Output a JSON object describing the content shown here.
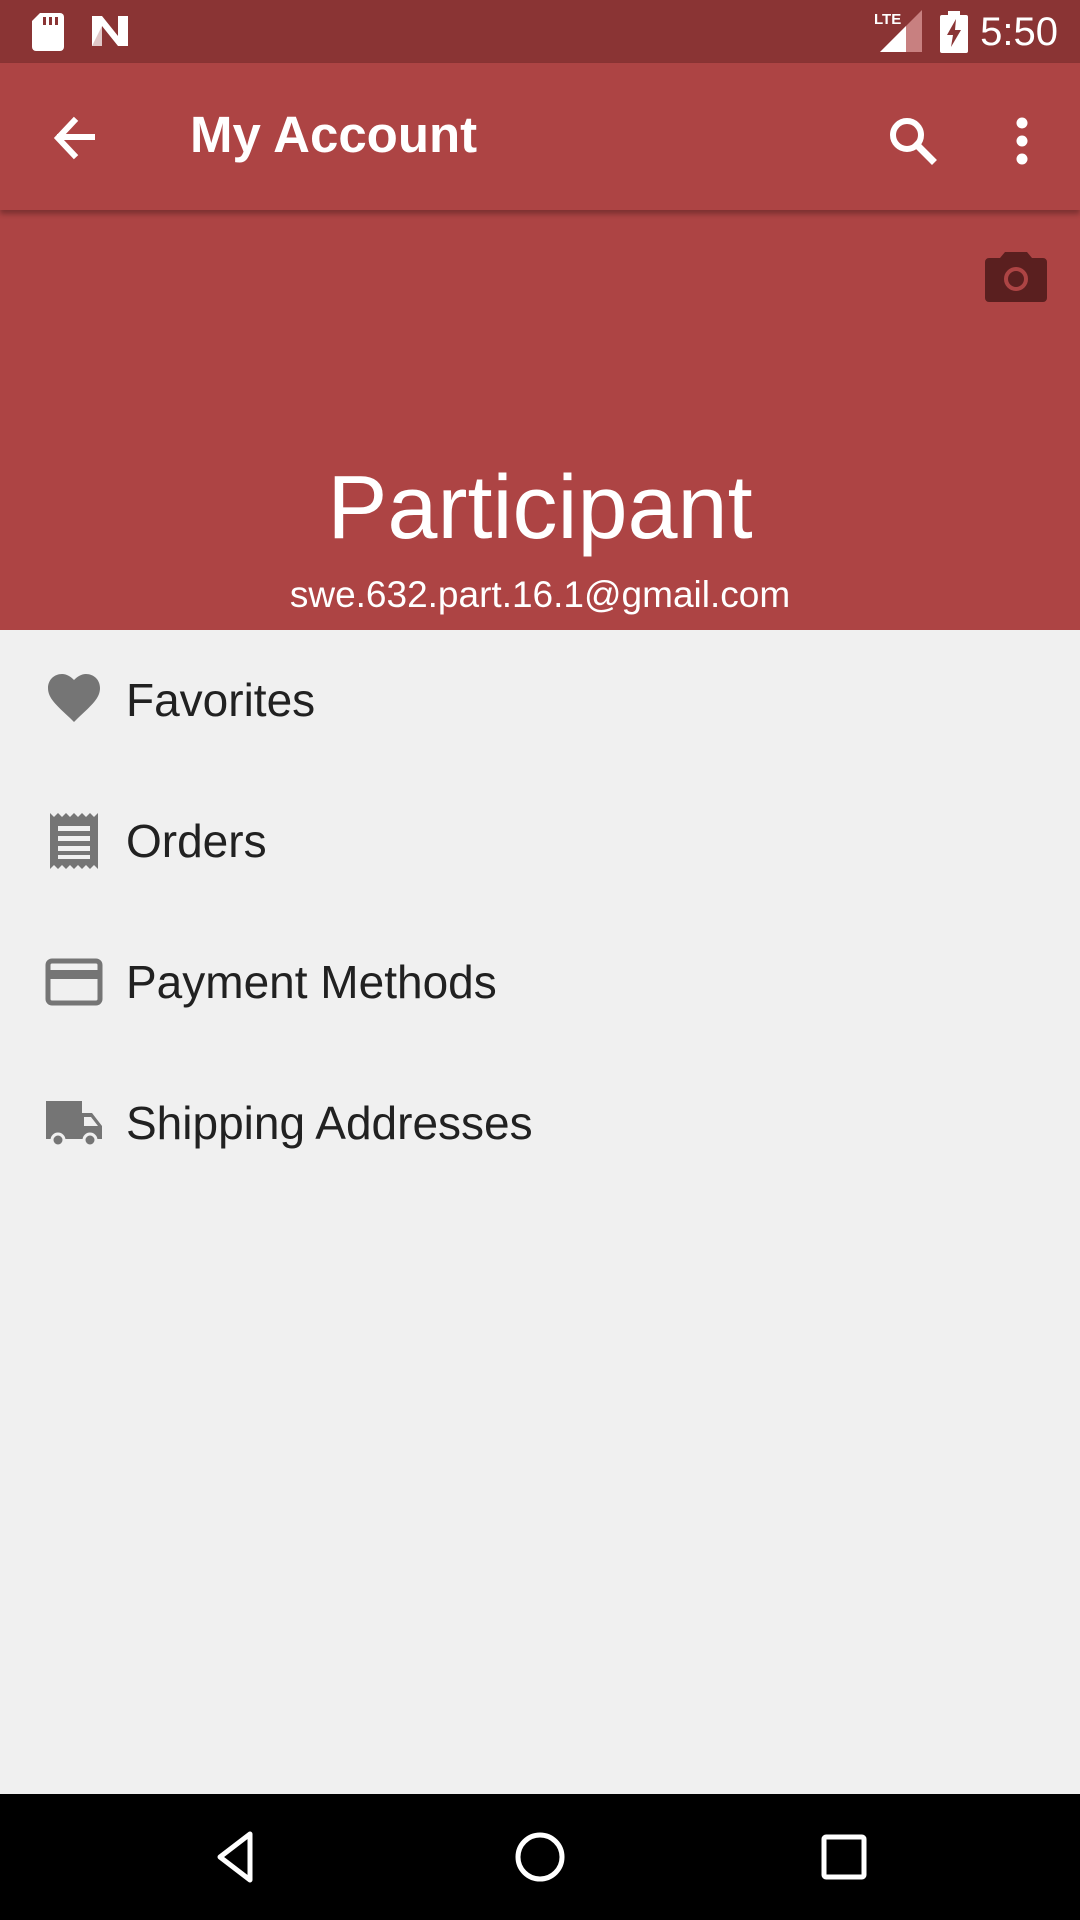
{
  "status_bar": {
    "time": "5:50",
    "icons": [
      "sd-card-icon",
      "n-logo-icon",
      "lte-signal-icon",
      "battery-charging-icon"
    ],
    "background": "#8a3434"
  },
  "app_bar": {
    "title": "My Account",
    "back_icon": "arrow-back-icon",
    "search_icon": "search-icon",
    "more_icon": "more-vert-icon",
    "background": "#ad4444"
  },
  "profile": {
    "name": "Participant",
    "email": "swe.632.part.16.1@gmail.com",
    "camera_icon": "camera-icon",
    "background": "#ad4444"
  },
  "menu": {
    "items": [
      {
        "label": "Favorites",
        "icon": "heart-icon"
      },
      {
        "label": "Orders",
        "icon": "receipt-icon"
      },
      {
        "label": "Payment Methods",
        "icon": "credit-card-icon"
      },
      {
        "label": "Shipping Addresses",
        "icon": "truck-icon"
      }
    ]
  },
  "nav_bar": {
    "icons": [
      "nav-back-icon",
      "nav-home-icon",
      "nav-recents-icon"
    ]
  },
  "colors": {
    "primary": "#ad4444",
    "primary_dark": "#8a3434",
    "background": "#f0f0f0",
    "icon_gray": "#757575",
    "text": "#212121"
  }
}
